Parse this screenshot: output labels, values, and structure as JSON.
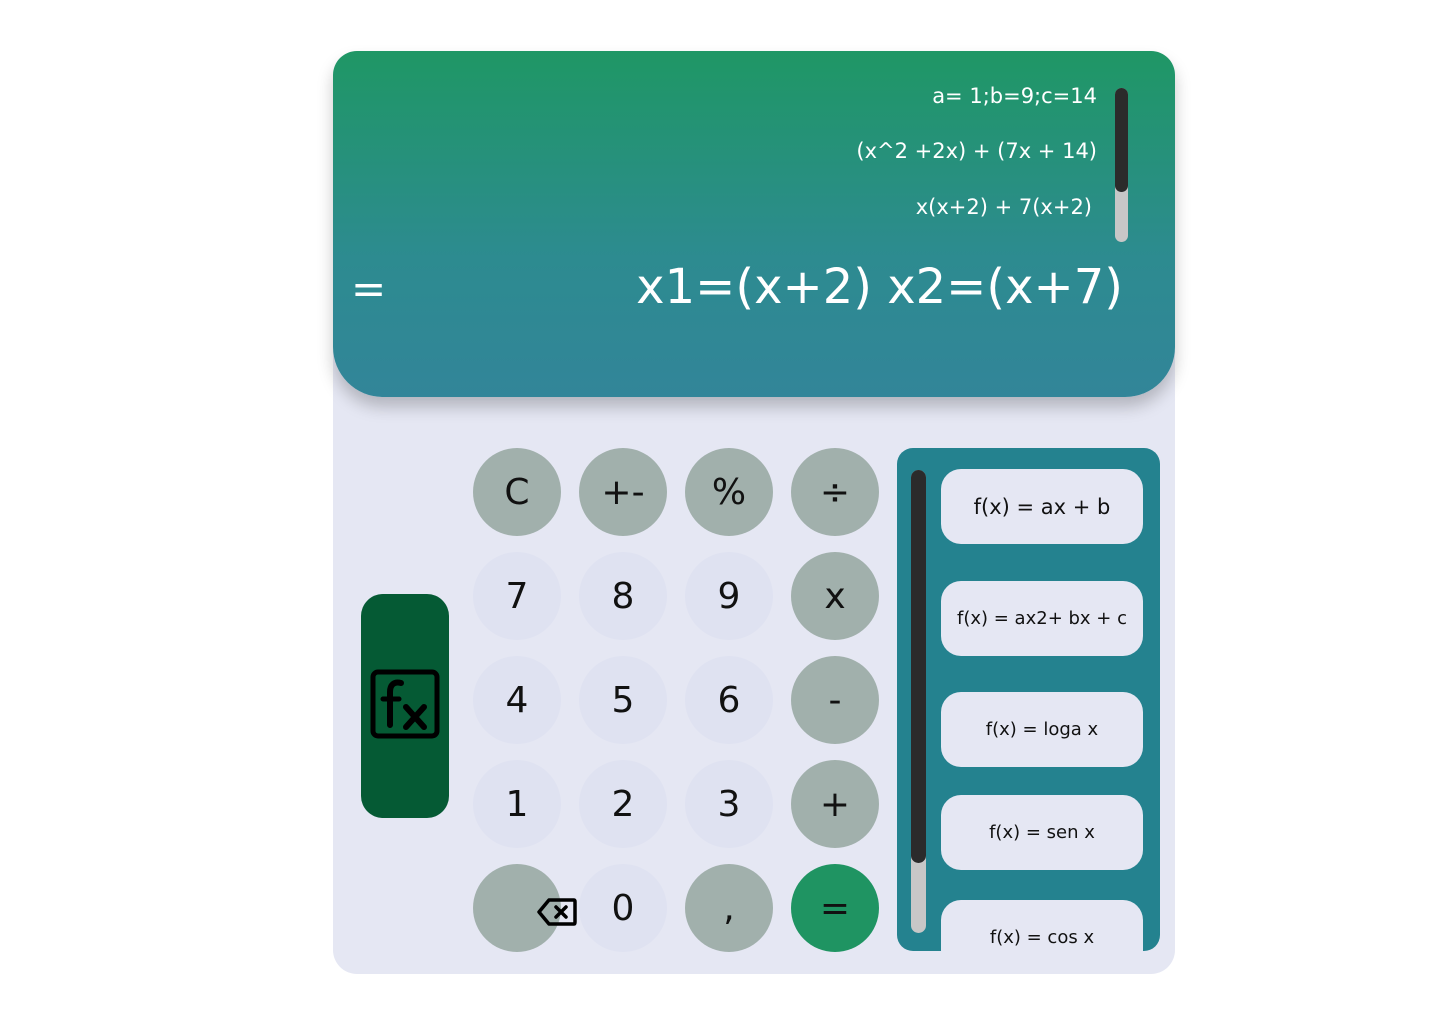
{
  "display": {
    "history": [
      "a= 1;b=9;c=14",
      "(x^2 +2x) + (7x + 14)",
      "x(x+2) + 7(x+2)"
    ],
    "equals_symbol": "=",
    "result": "x1=(x+2) x2=(x+7)"
  },
  "keypad": {
    "clear": "C",
    "plus_minus": "+-",
    "percent": "%",
    "divide": "÷",
    "seven": "7",
    "eight": "8",
    "nine": "9",
    "multiply": "x",
    "four": "4",
    "five": "5",
    "six": "6",
    "minus": "-",
    "one": "1",
    "two": "2",
    "three": "3",
    "plus": "+",
    "backspace_icon": "backspace-icon",
    "zero": "0",
    "comma": ",",
    "equals": "="
  },
  "function_button": {
    "icon": "function-fx-icon"
  },
  "functions": [
    "f(x) = ax + b",
    "f(x) = ax2+ bx + c",
    "f(x) = loga x",
    "f(x) = sen x",
    "f(x) = cos x"
  ],
  "colors": {
    "display_top": "#1f9765",
    "display_bottom": "#328599",
    "operator_key": "#a1b0ac",
    "number_key": "#dfe2f1",
    "equals_key": "#1f9462",
    "fx_button": "#055a34",
    "function_panel": "#24828f"
  }
}
